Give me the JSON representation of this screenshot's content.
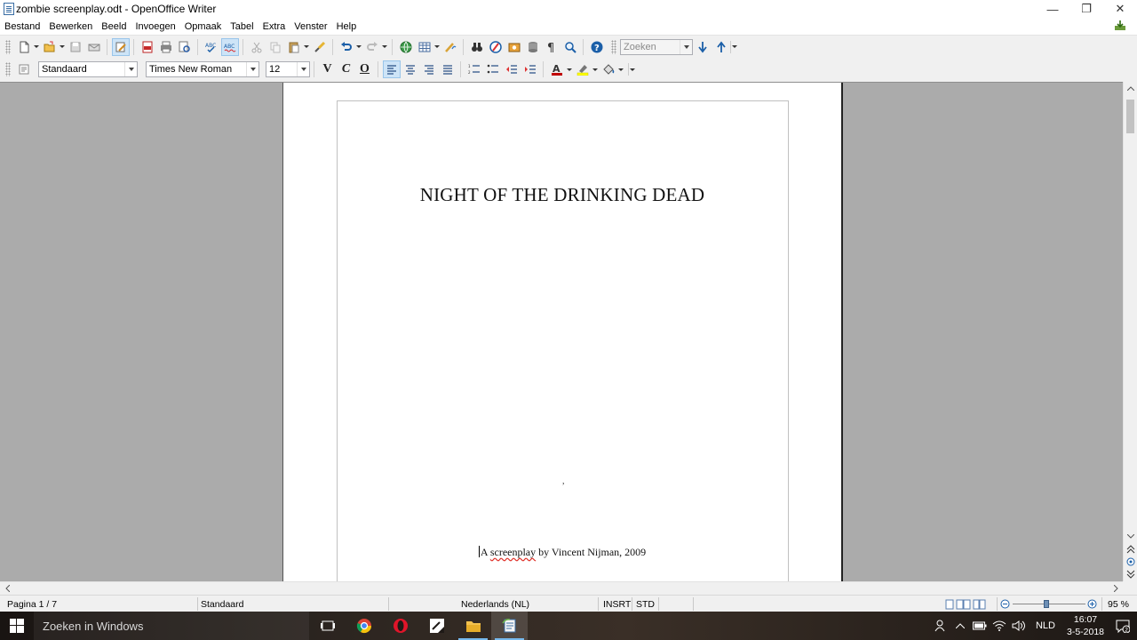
{
  "window": {
    "title": "zombie screenplay.odt - OpenOffice Writer",
    "minimize_glyph": "—",
    "maximize_glyph": "❐",
    "close_glyph": "✕"
  },
  "menu": {
    "items": [
      "Bestand",
      "Bewerken",
      "Beeld",
      "Invoegen",
      "Opmaak",
      "Tabel",
      "Extra",
      "Venster",
      "Help"
    ]
  },
  "toolbar_standard": {
    "find_placeholder": "Zoeken"
  },
  "toolbar_formatting": {
    "paragraph_style": "Standaard",
    "font_name": "Times New Roman",
    "font_size": "12",
    "bold_label": "V",
    "italic_label": "C",
    "underline_label": "O"
  },
  "document": {
    "title": "NIGHT OF THE DRINKING DEAD",
    "stray_mark": ",",
    "credit_prefix": "A ",
    "credit_misspelled": "screenplay",
    "credit_suffix": " by Vincent Nijman, 2009"
  },
  "statusbar": {
    "page": "Pagina 1 / 7",
    "page_style": "Standaard",
    "language": "Nederlands (NL)",
    "insert_mode": "INSRT",
    "selection_mode": "STD",
    "zoom": "95 %",
    "zoom_level_percent": 95
  },
  "taskbar": {
    "search_placeholder": "Zoeken in Windows",
    "language": "NLD",
    "time": "16:07",
    "date": "3-5-2018",
    "notification_count": "2"
  },
  "colors": {
    "accent": "#3a6ea5",
    "font_color": "#c00000",
    "highlight": "#ffff00",
    "spellcheck": "#e0322a"
  }
}
